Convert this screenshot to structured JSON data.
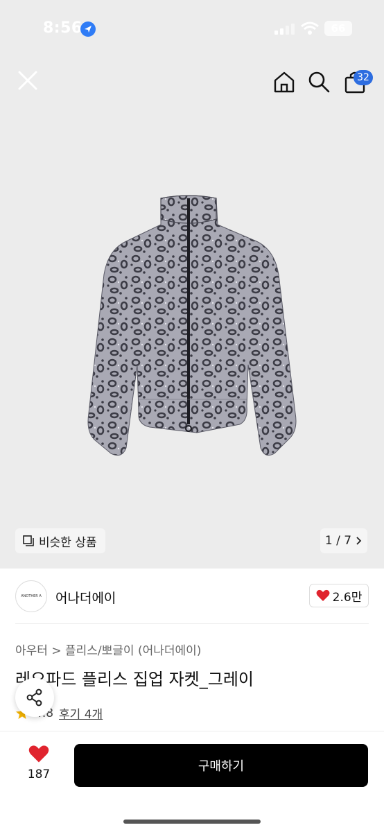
{
  "status_bar": {
    "time": "8:56",
    "battery": "66"
  },
  "top_nav": {
    "cart_count": "32"
  },
  "gallery": {
    "similar_label": "비슷한 상품",
    "pager": "1 / 7"
  },
  "brand": {
    "logo_text": "ANOTHER A",
    "name": "어나더에이",
    "likes": "2.6만"
  },
  "breadcrumb": {
    "category": "아우터",
    "separator": ">",
    "subcategory": "플리스/뽀글이 (어나더에이)"
  },
  "product": {
    "title": "레오파드 플리스 집업 자켓_그레이",
    "rating": "4.8",
    "reviews": "후기 4개"
  },
  "bottom_bar": {
    "wish_count": "187",
    "buy_label": "구매하기"
  },
  "colors": {
    "accent": "#2d6de0",
    "heart": "#e0242e",
    "buy_button": "#000000",
    "hero_bg": "#ececec"
  }
}
